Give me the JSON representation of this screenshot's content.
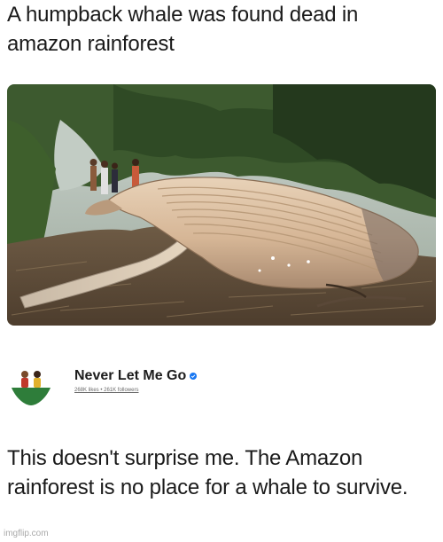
{
  "post": {
    "headline": "A humpback whale was found dead in amazon rainforest",
    "caption": "This doesn't surprise me. The Amazon rainforest is no place for a whale to survive."
  },
  "page": {
    "name": "Never Let Me Go",
    "stats": "268K likes • 261K followers",
    "verified_color": "#1877f2"
  },
  "photo": {
    "subject": "humpback whale carcass in jungle clearing"
  },
  "watermark": "imgflip.com"
}
